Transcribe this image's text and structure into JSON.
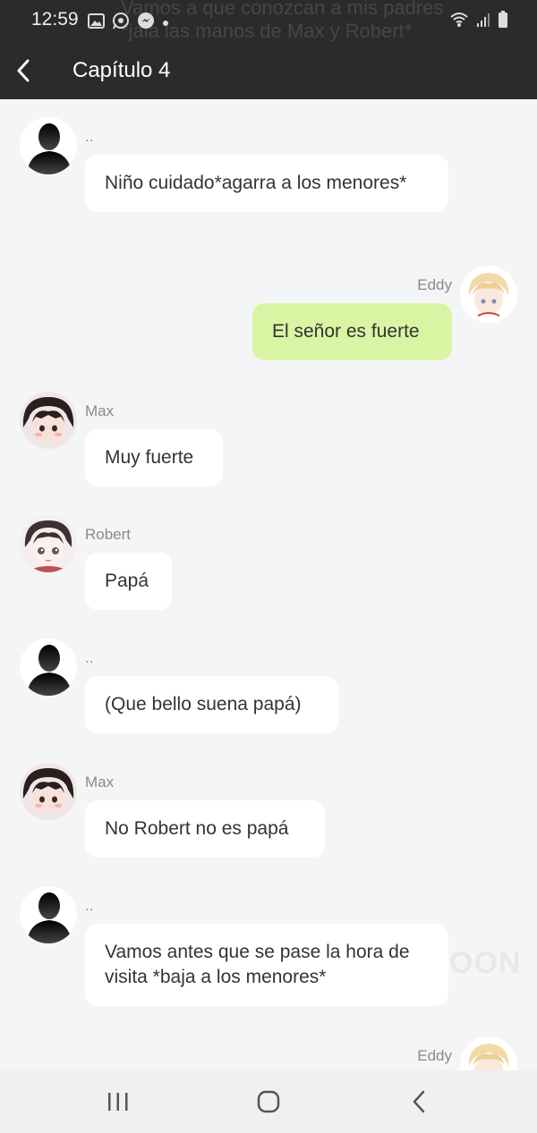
{
  "status_bar": {
    "time": "12:59",
    "icons_left": [
      "gallery-icon",
      "whatsapp-icon",
      "messenger-icon",
      "dot-icon"
    ],
    "icons_right": [
      "wifi-icon",
      "signal-icon",
      "battery-icon"
    ]
  },
  "header": {
    "title": "Capítulo 4",
    "background_text": "Vamos a que conozcan a mis padres *jala las manos de Max y Robert*"
  },
  "messages": [
    {
      "side": "left",
      "avatar": "silhouette",
      "name": "..",
      "text": "Niño cuidado*agarra a los menores*"
    },
    {
      "side": "right",
      "avatar": "eddy",
      "name": "Eddy",
      "text": "El señor es fuerte"
    },
    {
      "side": "left",
      "avatar": "max",
      "name": "Max",
      "text": "Muy fuerte"
    },
    {
      "side": "left",
      "avatar": "robert",
      "name": "Robert",
      "text": "Papá"
    },
    {
      "side": "left",
      "avatar": "silhouette",
      "name": "..",
      "text": "(Que bello suena papá)"
    },
    {
      "side": "left",
      "avatar": "max",
      "name": "Max",
      "text": "No Robert no es papá"
    },
    {
      "side": "left",
      "avatar": "silhouette",
      "name": "..",
      "text": "Vamos antes que se pase la hora de visita *baja a los menores*"
    },
    {
      "side": "right",
      "avatar": "eddy",
      "name": "Eddy",
      "text": ""
    }
  ],
  "watermark": "OON",
  "colors": {
    "topbar": "#2b2b2b",
    "chat_background": "#f4f5f7",
    "bubble_left": "#ffffff",
    "bubble_right": "#d9f5a3",
    "name_text": "#8a8a8a"
  },
  "nav": {
    "buttons": [
      "recent-apps-icon",
      "home-icon",
      "back-icon"
    ]
  }
}
